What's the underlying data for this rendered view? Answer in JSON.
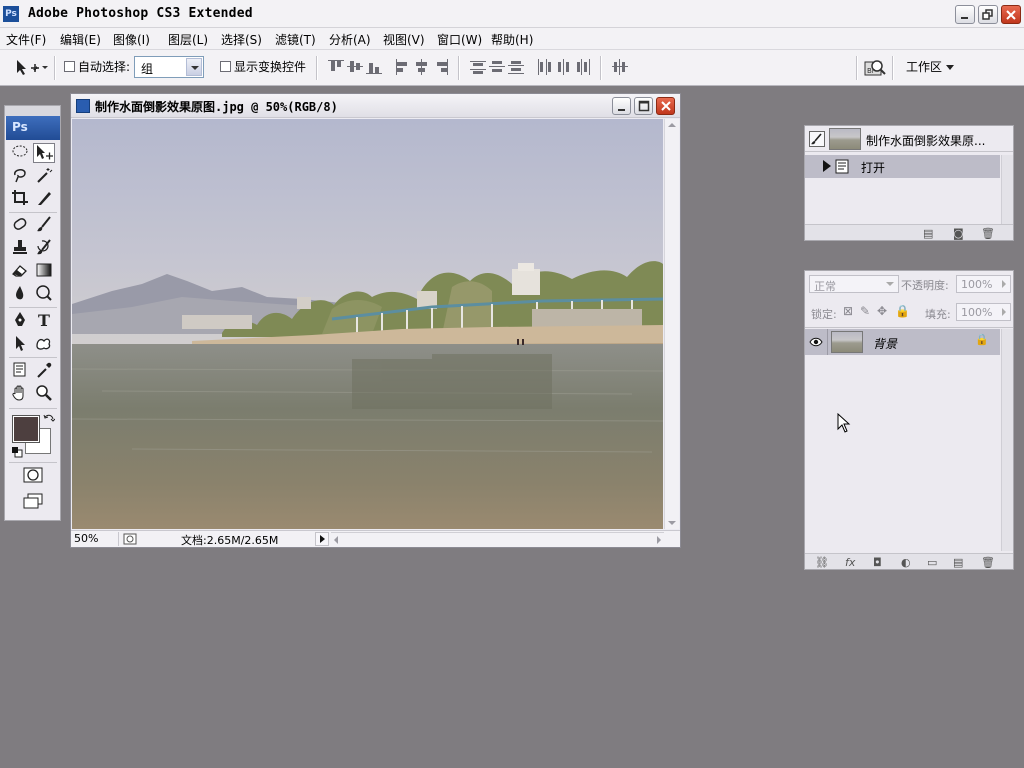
{
  "app": {
    "logo": "Ps",
    "title": "Adobe Photoshop CS3 Extended"
  },
  "menu": [
    "文件(F)",
    "编辑(E)",
    "图像(I)",
    "图层(L)",
    "选择(S)",
    "滤镜(T)",
    "分析(A)",
    "视图(V)",
    "窗口(W)",
    "帮助(H)"
  ],
  "options": {
    "auto_select_label": "自动选择:",
    "auto_select_value": "组",
    "show_transform_label": "显示变换控件",
    "workspace_label": "工作区"
  },
  "toolbox": {
    "logo": "Ps",
    "text_tool": "T"
  },
  "document": {
    "title": "制作水面倒影效果原图.jpg @ 50%(RGB/8)",
    "zoom": "50%",
    "doc_size": "文档:2.65M/2.65M"
  },
  "history": {
    "snapshot_label": "制作水面倒影效果原...",
    "items": [
      "打开"
    ]
  },
  "layers": {
    "blend_mode": "正常",
    "opacity_label": "不透明度:",
    "opacity_value": "100%",
    "lock_label": "锁定:",
    "fill_label": "填充:",
    "fill_value": "100%",
    "layer_name": "背景"
  },
  "colors": {
    "foreground": "#4d3f3f",
    "background": "#ffffff",
    "workspace_bg": "#7f7c80",
    "close_button": "#d2482b"
  }
}
